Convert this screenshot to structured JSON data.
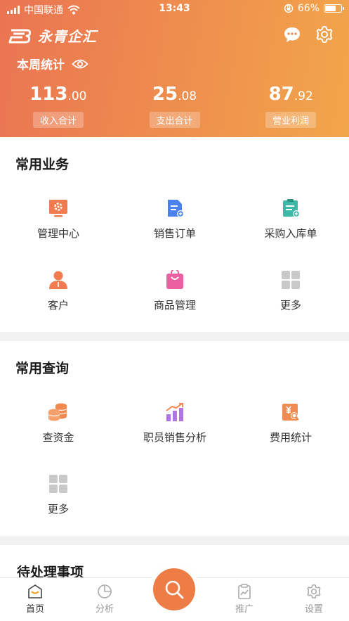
{
  "status_bar": {
    "carrier": "中国联通",
    "time": "13:43",
    "battery": "66%",
    "battery_level": 0.66
  },
  "header": {
    "brand": "永青企汇",
    "week_label": "本周统计",
    "stats": [
      {
        "int": "113",
        "dec": ".00",
        "label": "收入合计"
      },
      {
        "int": "25",
        "dec": ".08",
        "label": "支出合计"
      },
      {
        "int": "87",
        "dec": ".92",
        "label": "营业利润"
      }
    ]
  },
  "common_business": {
    "title": "常用业务",
    "items": [
      {
        "label": "管理中心",
        "icon": "management-center-icon"
      },
      {
        "label": "销售订单",
        "icon": "sales-order-icon"
      },
      {
        "label": "采购入库单",
        "icon": "purchase-receipt-icon"
      },
      {
        "label": "客户",
        "icon": "customer-icon"
      },
      {
        "label": "商品管理",
        "icon": "product-bag-icon"
      },
      {
        "label": "更多",
        "icon": "more-grid-icon"
      }
    ]
  },
  "common_query": {
    "title": "常用查询",
    "items": [
      {
        "label": "查资金",
        "icon": "coins-icon"
      },
      {
        "label": "职员销售分析",
        "icon": "sales-chart-icon"
      },
      {
        "label": "费用统计",
        "icon": "expense-search-icon"
      },
      {
        "label": "更多",
        "icon": "more-grid-icon"
      }
    ]
  },
  "pending": {
    "title": "待处理事项"
  },
  "tabbar": {
    "tabs": [
      {
        "label": "首页",
        "icon": "home-icon"
      },
      {
        "label": "分析",
        "icon": "pie-chart-icon"
      },
      {
        "label": "推广",
        "icon": "clipboard-chart-icon"
      },
      {
        "label": "设置",
        "icon": "settings-icon"
      }
    ]
  },
  "colors": {
    "header_start": "#ea7452",
    "header_end": "#f2a64a",
    "accent": "#ee7d45"
  }
}
